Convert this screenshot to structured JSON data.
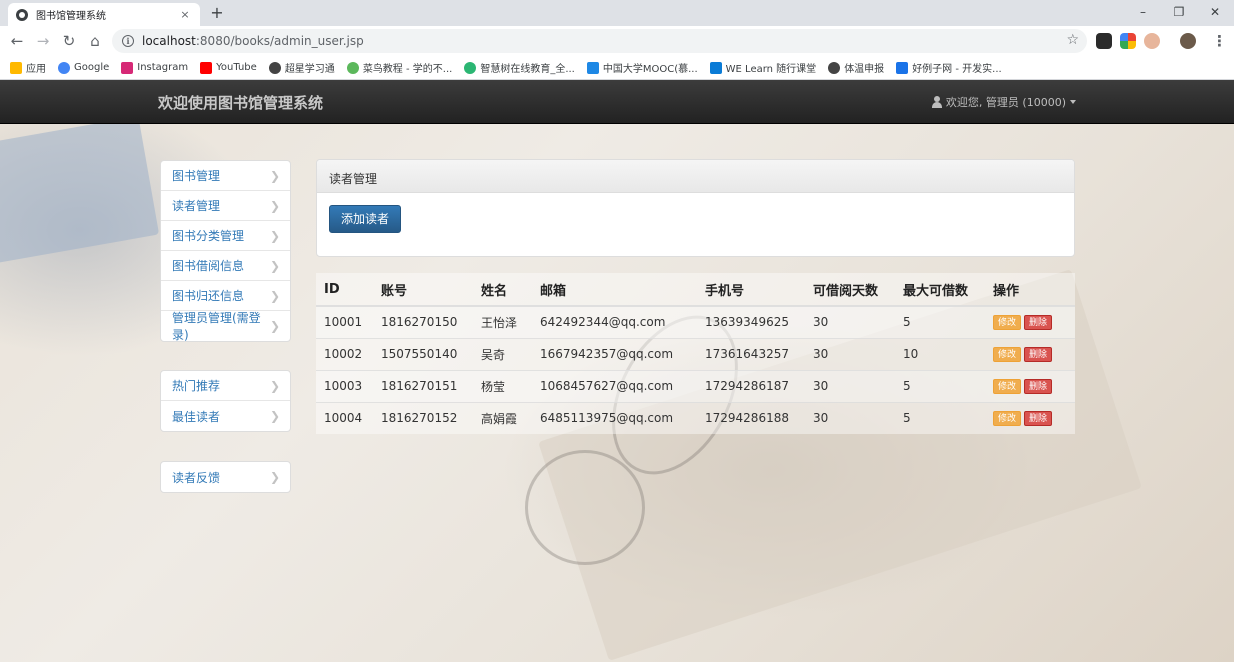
{
  "browser": {
    "tab_title": "图书馆管理系统",
    "tab_close": "×",
    "new_tab": "+",
    "url_host": "localhost",
    "url_rest": ":8080/books/admin_user.jsp",
    "bookmarks": [
      "应用",
      "Google",
      "Instagram",
      "YouTube",
      "超星学习通",
      "菜鸟教程 - 学的不...",
      "智慧树在线教育_全...",
      "中国大学MOOC(慕...",
      "WE Learn 随行课堂",
      "体温申报",
      "好例子网 - 开发实..."
    ],
    "bookmark_colors": [
      "#ffb900",
      "#4285f4",
      "#d62976",
      "#ff0000",
      "#444444",
      "#5cb85c",
      "#2bb673",
      "#1e88e5",
      "#0a7bd6",
      "#444444",
      "#1a73e8"
    ]
  },
  "navbar": {
    "brand": "欢迎使用图书馆管理系统",
    "user_label": "欢迎您, 管理员 (10000)"
  },
  "sidebar": {
    "group1": [
      "图书管理",
      "读者管理",
      "图书分类管理",
      "图书借阅信息",
      "图书归还信息",
      "管理员管理(需登录)"
    ],
    "group2": [
      "热门推荐",
      "最佳读者"
    ],
    "group3": [
      "读者反馈"
    ]
  },
  "panel": {
    "heading": "读者管理",
    "add_button": "添加读者"
  },
  "table": {
    "headers": [
      "ID",
      "账号",
      "姓名",
      "邮箱",
      "手机号",
      "可借阅天数",
      "最大可借数",
      "操作"
    ],
    "rows": [
      [
        "10001",
        "1816270150",
        "王怡泽",
        "642492344@qq.com",
        "13639349625",
        "30",
        "5"
      ],
      [
        "10002",
        "1507550140",
        "吴奇",
        "1667942357@qq.com",
        "17361643257",
        "30",
        "10"
      ],
      [
        "10003",
        "1816270151",
        "杨莹",
        "1068457627@qq.com",
        "17294286187",
        "30",
        "5"
      ],
      [
        "10004",
        "1816270152",
        "高娟霞",
        "6485113975@qq.com",
        "17294286188",
        "30",
        "5"
      ]
    ],
    "edit_label": "修改",
    "delete_label": "删除"
  }
}
